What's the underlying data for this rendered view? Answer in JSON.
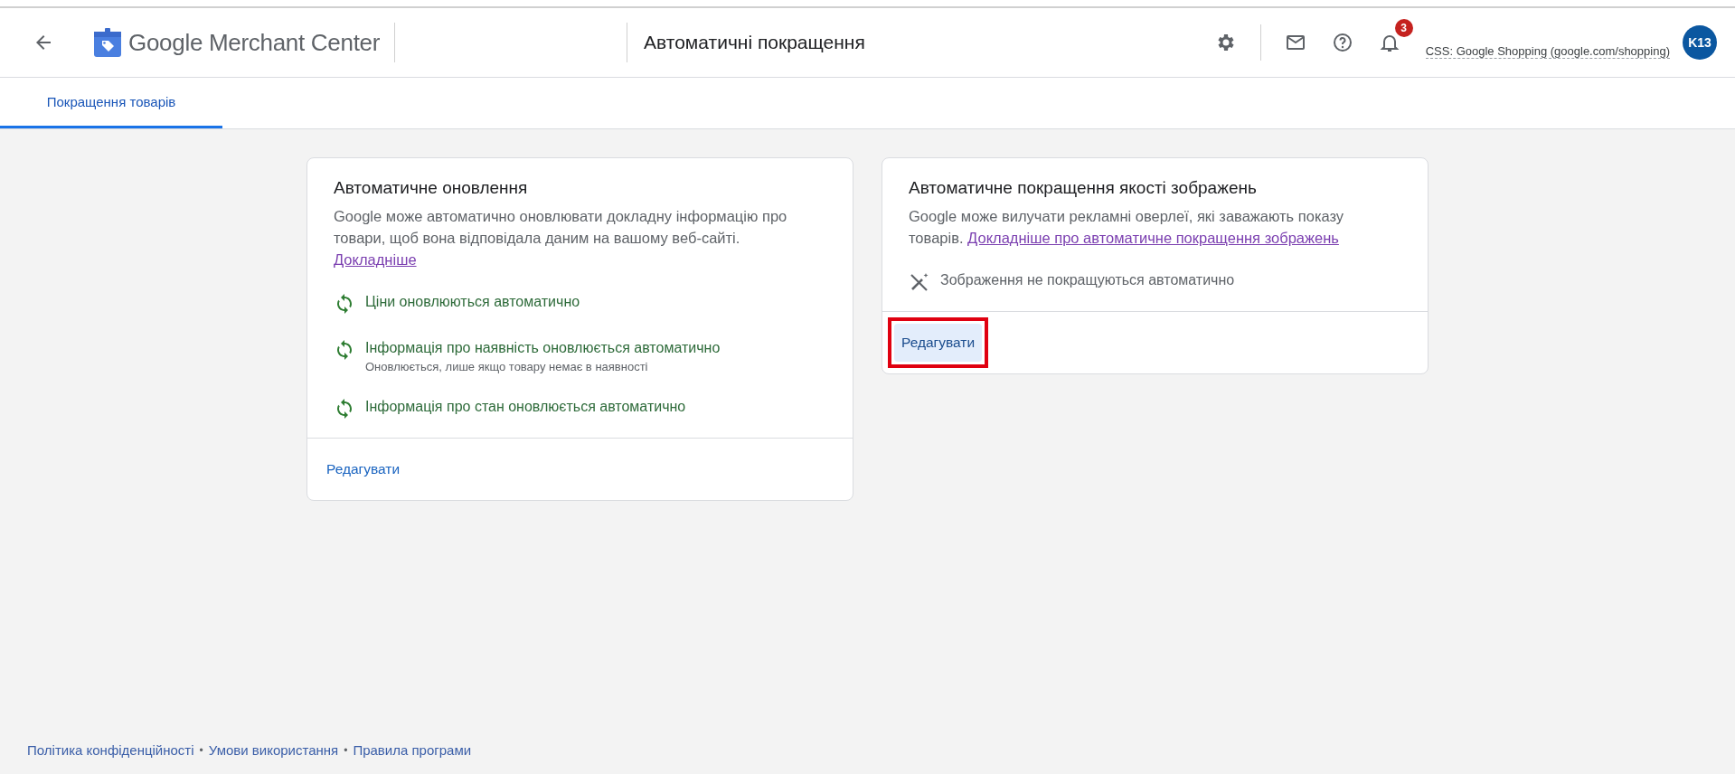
{
  "header": {
    "product": "Google Merchant Center",
    "page_title": "Автоматичні покращення",
    "notifications": "3",
    "account_label": "CSS: Google Shopping (google.com/shopping)",
    "avatar": "K13"
  },
  "tabs": [
    {
      "label": "Покращення товарів",
      "selected": true
    }
  ],
  "cards": [
    {
      "title": "Автоматичне оновлення",
      "description": "Google може автоматично оновлювати докладну інформацію про товари, щоб вона відповідала даним на вашому веб-сайті.",
      "link": "Докладніше",
      "statuses": [
        {
          "kind": "sync",
          "text": "Ціни оновлюються автоматично"
        },
        {
          "kind": "sync",
          "text": "Інформація про наявність оновлюється автоматично",
          "note": "Оновлюється, лише якщо товару немає в наявності"
        },
        {
          "kind": "sync",
          "text": "Інформація про стан оновлюється автоматично"
        }
      ],
      "action": {
        "label": "Редагувати",
        "focused": false,
        "annotated": false
      }
    },
    {
      "title": "Автоматичне покращення якості зображень",
      "description": "Google може вилучати рекламні оверлеї, які заважають показу товарів.",
      "link": "Докладніше про автоматичне покращення зображень",
      "statuses": [
        {
          "kind": "off",
          "text": "Зображення не покращуються автоматично"
        }
      ],
      "action": {
        "label": "Редагувати",
        "focused": true,
        "annotated": true
      }
    }
  ],
  "footer": {
    "items": [
      {
        "kind": "link",
        "text": "Політика конфіденційності"
      },
      {
        "kind": "separator",
        "text": "•"
      },
      {
        "kind": "link",
        "text": "Умови використання"
      },
      {
        "kind": "separator",
        "text": "•"
      },
      {
        "kind": "link",
        "text": "Правила програми"
      }
    ]
  }
}
